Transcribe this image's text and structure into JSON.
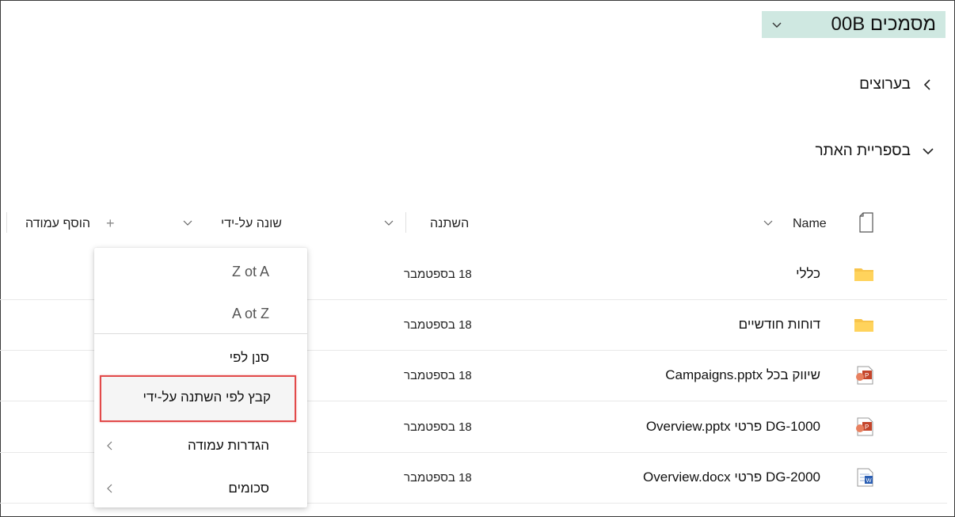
{
  "library": {
    "title": "מסמכים 00B"
  },
  "sections": [
    {
      "label": "בערוצים",
      "state": "collapsed"
    },
    {
      "label": "בספריית האתר",
      "state": "expanded"
    }
  ],
  "columns": {
    "name": "Name",
    "modified": "השתנה",
    "modified_by": "שונה על-ידי",
    "add_column": "הוסף עמודה",
    "add_symbol": "+"
  },
  "rows": [
    {
      "name": "כללי",
      "modified": "18 בספטמבר",
      "icon": "folder-icon"
    },
    {
      "name": "דוחות חודשיים",
      "modified": "18 בספטמבר",
      "icon": "folder-icon"
    },
    {
      "name": "שיווק בכל Campaigns.pptx",
      "modified": "18 בספטמבר",
      "icon": "powerpoint-icon"
    },
    {
      "name": "DG-1000 פרטי Overview.pptx",
      "modified": "18 בספטמבר",
      "icon": "powerpoint-icon"
    },
    {
      "name": "DG-2000 פרטי Overview.docx",
      "modified": "18 בספטמבר",
      "icon": "word-icon"
    }
  ],
  "menu": {
    "items": [
      {
        "label": "Z ot A"
      },
      {
        "label": "A ot Z"
      },
      {
        "label": "סנן לפי"
      },
      {
        "label": "קבץ לפי השתנה על-ידי"
      },
      {
        "label": "הגדרות עמודה"
      },
      {
        "label": "סכומים"
      }
    ]
  },
  "colors": {
    "header_bg": "#cfe8e1",
    "folder": "#f8c44a",
    "powerpoint": "#c4452b",
    "word": "#2b5fb4",
    "highlight": "#e24a4a"
  }
}
